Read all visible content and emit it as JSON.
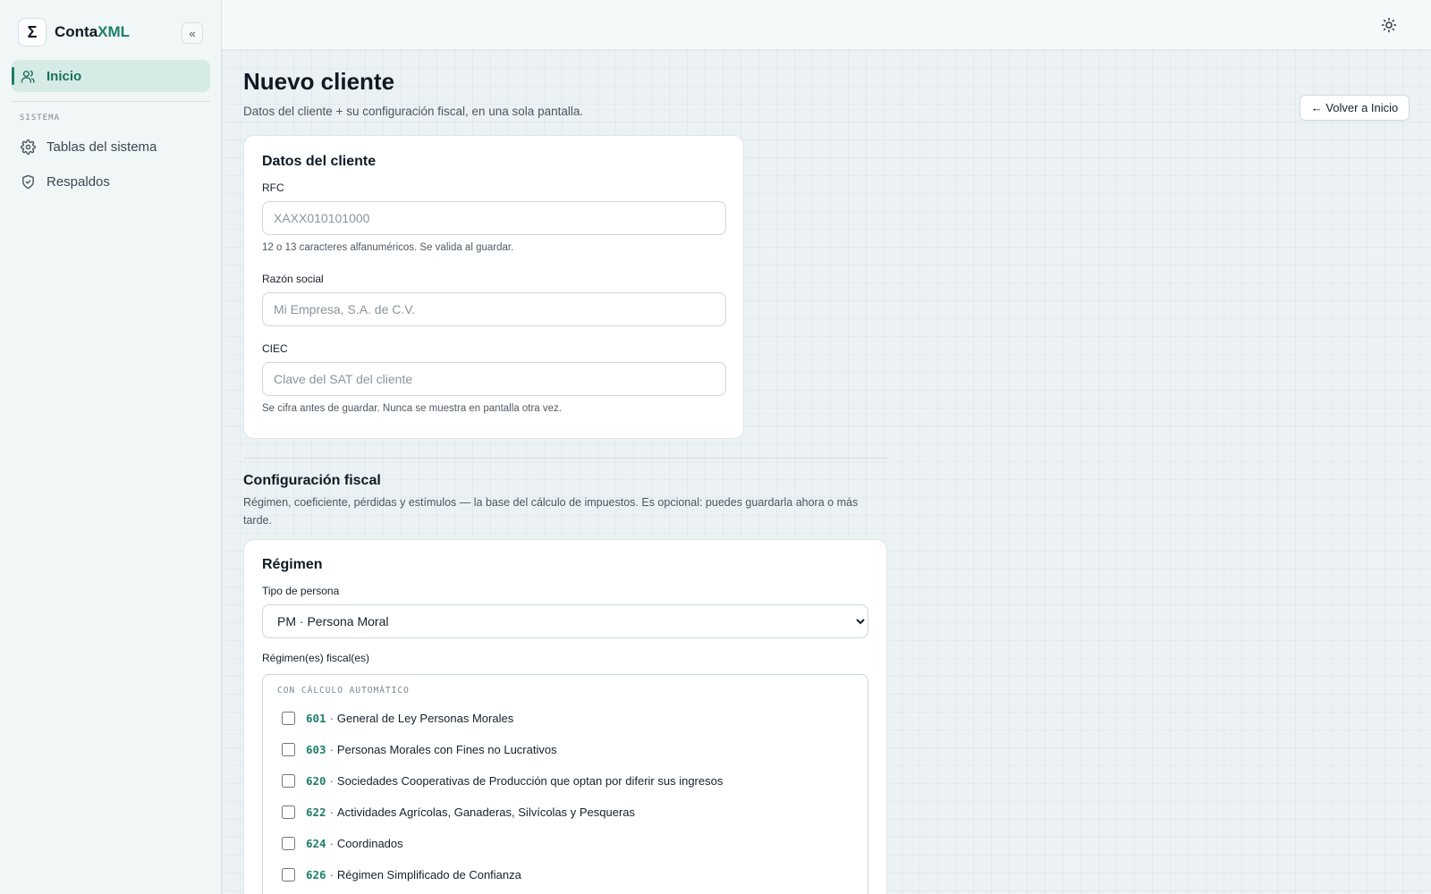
{
  "brand": {
    "logo": "Σ",
    "name_prefix": "Conta",
    "name_accent": "XML",
    "collapse_label": "«"
  },
  "sidebar": {
    "items": [
      {
        "label": "Inicio",
        "icon": "users-icon",
        "active": true
      }
    ],
    "section_label": "SISTEMA",
    "system_items": [
      {
        "label": "Tablas del sistema",
        "icon": "gear-icon"
      },
      {
        "label": "Respaldos",
        "icon": "shield-check-icon"
      }
    ]
  },
  "topbar": {
    "theme_icon": "sun-icon"
  },
  "page": {
    "title": "Nuevo cliente",
    "subtitle": "Datos del cliente + su configuración fiscal, en una sola pantalla.",
    "back_label": "← Volver a Inicio"
  },
  "client_card": {
    "title": "Datos del cliente",
    "rfc": {
      "label": "RFC",
      "value": "",
      "placeholder": "XAXX010101000",
      "hint": "12 o 13 caracteres alfanuméricos. Se valida al guardar."
    },
    "razon": {
      "label": "Razón social",
      "value": "",
      "placeholder": "Mi Empresa, S.A. de C.V."
    },
    "ciec": {
      "label": "CIEC",
      "value": "",
      "placeholder": "Clave del SAT del cliente",
      "hint": "Se cifra antes de guardar. Nunca se muestra en pantalla otra vez."
    }
  },
  "fiscal": {
    "title": "Configuración fiscal",
    "description": "Régimen, coeficiente, pérdidas y estímulos — la base del cálculo de impuestos. Es opcional: puedes guardarla ahora o más tarde."
  },
  "regimen_card": {
    "title": "Régimen",
    "persona_label": "Tipo de persona",
    "persona_selected": "PM · Persona Moral",
    "regimenes_label": "Régimen(es) fiscal(es)",
    "group_label": "CON CÁLCULO AUTOMÁTICO",
    "items": [
      {
        "code": "601",
        "name": "General de Ley Personas Morales",
        "checked": false
      },
      {
        "code": "603",
        "name": "Personas Morales con Fines no Lucrativos",
        "checked": false
      },
      {
        "code": "620",
        "name": "Sociedades Cooperativas de Producción que optan por diferir sus ingresos",
        "checked": false
      },
      {
        "code": "622",
        "name": "Actividades Agrícolas, Ganaderas, Silvícolas y Pesqueras",
        "checked": false
      },
      {
        "code": "624",
        "name": "Coordinados",
        "checked": false
      },
      {
        "code": "626",
        "name": "Régimen Simplificado de Confianza",
        "checked": false
      }
    ]
  },
  "colors": {
    "accent": "#1e7f6c",
    "active_bg": "#d6ebe6"
  }
}
